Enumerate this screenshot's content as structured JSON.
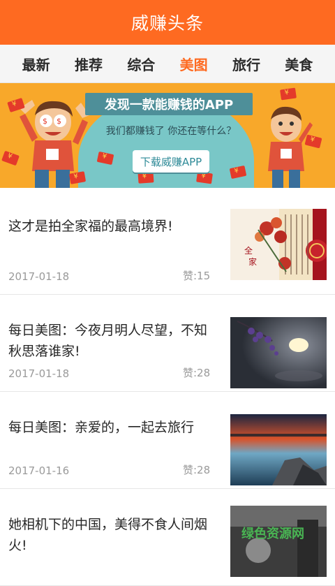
{
  "header": {
    "title": "威赚头条"
  },
  "tabs": [
    {
      "label": "最新",
      "active": false
    },
    {
      "label": "推荐",
      "active": false
    },
    {
      "label": "综合",
      "active": false
    },
    {
      "label": "美图",
      "active": true
    },
    {
      "label": "旅行",
      "active": false
    },
    {
      "label": "美食",
      "active": false
    }
  ],
  "banner": {
    "headline": "发现一款能赚钱的APP",
    "subline": "我们都赚钱了 你还在等什么？",
    "button": "下载威赚APP",
    "colors": {
      "background": "#f8a82a",
      "arc": "#79c7c7",
      "headline_bg": "#4e8f99",
      "envelope": "#e43a2a"
    }
  },
  "articles": [
    {
      "title": "这才是拍全家福的最高境界!",
      "date": "2017-01-18",
      "likes": "赞:15",
      "image": "chinese-calligraphy-flowers"
    },
    {
      "title": "每日美图：今夜月明人尽望，不知秋思落谁家!",
      "date": "2017-01-18",
      "likes": "赞:28",
      "image": "night-moon-flowers"
    },
    {
      "title": "每日美图：亲爱的，一起去旅行",
      "date": "2017-01-16",
      "likes": "赞:28",
      "image": "sunset-seascape"
    },
    {
      "title": "她相机下的中国，美得不食人间烟火!",
      "image": "black-white-photo"
    }
  ],
  "watermark": "绿色资源网",
  "accent": "#fe6a21"
}
